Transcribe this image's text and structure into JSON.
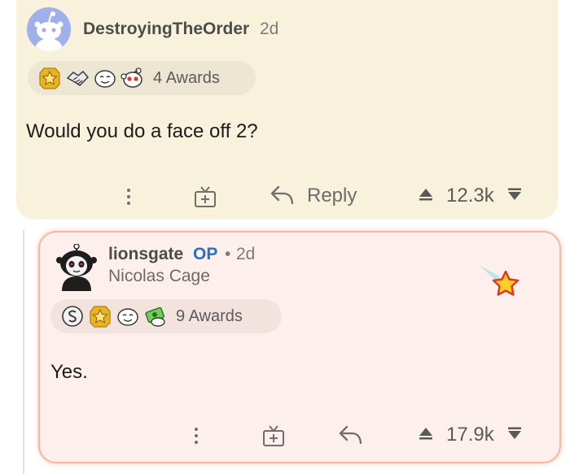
{
  "comment1": {
    "username": "DestroyingTheOrder",
    "age": "2d",
    "awards_label": "4 Awards",
    "awards_icons": [
      "gold-award-icon",
      "handshake-award-icon",
      "smile-award-icon",
      "helpful-award-icon"
    ],
    "body": "Would you do a face off 2?",
    "reply_label": "Reply",
    "score": "12.3k"
  },
  "comment2": {
    "username": "lionsgate",
    "op_badge": "OP",
    "separator": "•",
    "age": "2d",
    "flair": "Nicolas Cage",
    "awards_label": "9 Awards",
    "awards_icons": [
      "silver-award-icon",
      "gold-award-icon",
      "smile-award-icon",
      "money-award-icon"
    ],
    "body": "Yes.",
    "score": "17.9k"
  },
  "colors": {
    "comment1_bg": "#f8f2dc",
    "comment2_bg": "#fdf0ec",
    "highlight_border": "#f4b8a4",
    "op_blue": "#2c6fc9"
  }
}
